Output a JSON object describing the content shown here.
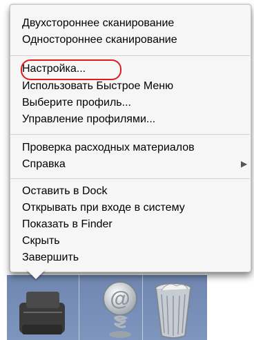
{
  "menu": {
    "items": [
      {
        "label": "Двухстороннее сканирование"
      },
      {
        "label": "Одностороннее сканирование"
      },
      {
        "label": "Настройка..."
      },
      {
        "label": "Использовать Быстрое Меню"
      },
      {
        "label": "Выберите профиль..."
      },
      {
        "label": "Управление профилями..."
      },
      {
        "label": "Проверка расходных материалов"
      },
      {
        "label": "Справка"
      },
      {
        "label": "Оставить в Dock"
      },
      {
        "label": "Открывать при входе в систему"
      },
      {
        "label": "Показать в Finder"
      },
      {
        "label": "Скрыть"
      },
      {
        "label": "Завершить"
      }
    ],
    "submenu_indicator": "▶",
    "highlight_color": "#e01b1b"
  },
  "dock": {
    "icons": [
      {
        "name": "scanner-app-icon"
      },
      {
        "name": "mail-at-icon"
      },
      {
        "name": "trash-icon"
      }
    ]
  }
}
